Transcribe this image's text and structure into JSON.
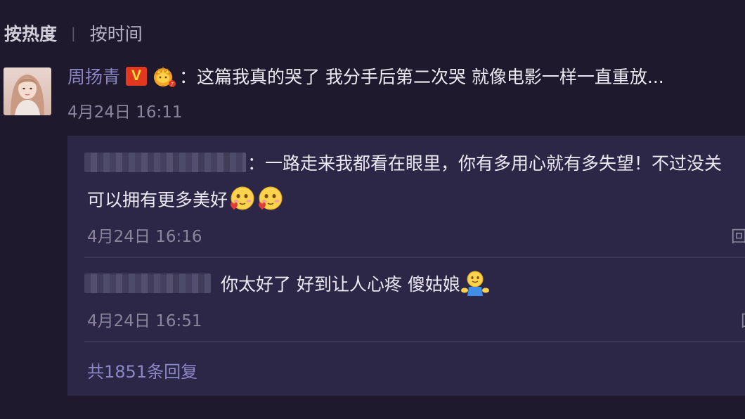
{
  "sort": {
    "by_hot": "按热度",
    "separator": "|",
    "by_time": "按时间"
  },
  "comment": {
    "username": "周扬青",
    "verified_badge": "V",
    "text": "：这篇我真的哭了 我分手后第二次哭 就像电影一样一直重放...",
    "date": "4月24日 16:11"
  },
  "replies": [
    {
      "text_line1": "：一路走来我都看在眼里，你有多用心就有多失望！不过没关",
      "text_line2": "可以拥有更多美好",
      "emoji": "blush-heart-emoji",
      "date": "4月24日 16:16",
      "action": "回"
    },
    {
      "text": "你太好了 好到让人心疼 傻姑娘",
      "emoji": "hug-emoji",
      "date": "4月24日 16:51",
      "action": "回"
    }
  ],
  "more_replies": "共1851条回复",
  "colors": {
    "background": "#1e192c",
    "reply_panel": "#2c2747",
    "username": "#8d86c4",
    "muted": "#8a849c",
    "verified_red": "#e2381f"
  }
}
